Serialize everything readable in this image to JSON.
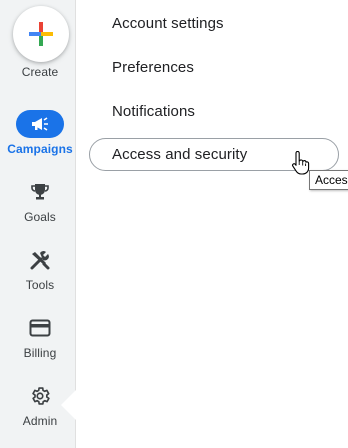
{
  "sidebar": {
    "create_label": "Create",
    "items": [
      {
        "label": "Campaigns",
        "icon": "megaphone-icon",
        "active": true
      },
      {
        "label": "Goals",
        "icon": "trophy-icon",
        "active": false
      },
      {
        "label": "Tools",
        "icon": "tools-icon",
        "active": false
      },
      {
        "label": "Billing",
        "icon": "credit-card-icon",
        "active": false
      },
      {
        "label": "Admin",
        "icon": "gear-icon",
        "active": false
      }
    ]
  },
  "admin_menu": {
    "items": [
      {
        "label": "Account settings"
      },
      {
        "label": "Preferences"
      },
      {
        "label": "Notifications"
      },
      {
        "label": "Access and security",
        "selected": true
      }
    ]
  },
  "tooltip": {
    "text": "Access"
  },
  "colors": {
    "accent": "#1a73e8",
    "rail_background": "#f1f3f4",
    "plus_blue": "#4285f4",
    "plus_red": "#ea4335",
    "plus_yellow": "#fbbc04",
    "plus_green": "#34a853"
  }
}
